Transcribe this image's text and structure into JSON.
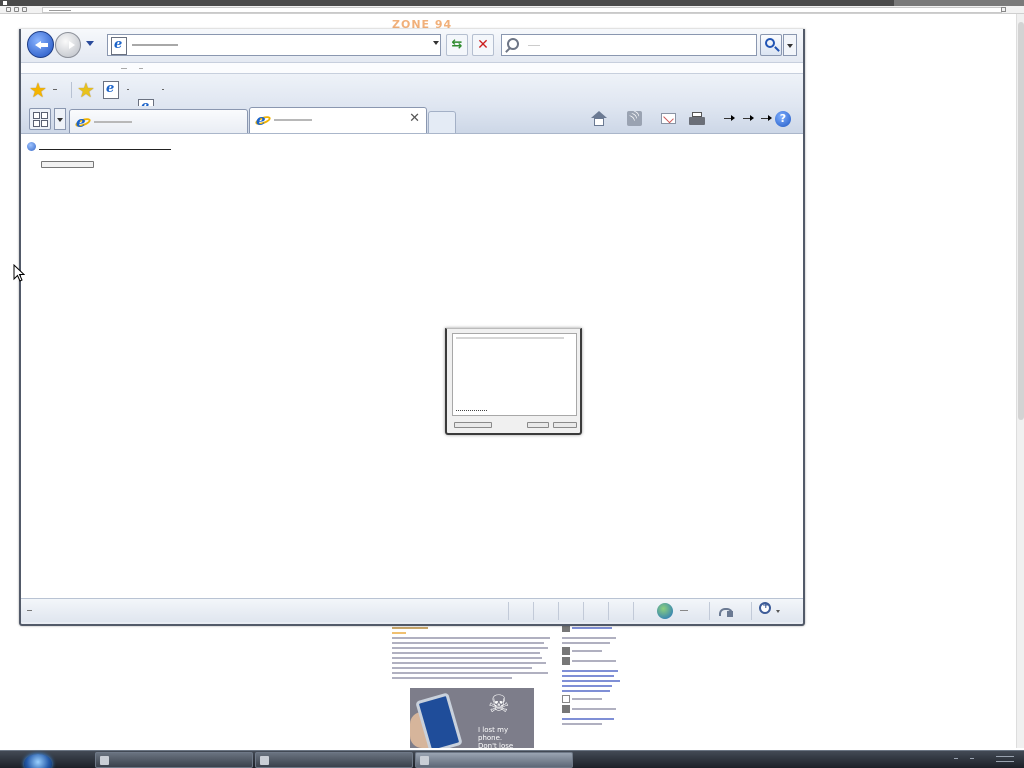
{
  "outer_page": {
    "logo_text": "ZONE 94",
    "ad_text": "I lost my phone.\nDon't lose yours."
  },
  "browser": {
    "address_bar": {
      "url": ""
    },
    "search_box": {
      "placeholder": ""
    },
    "tabs": [
      {
        "title": "",
        "state": "inactive"
      },
      {
        "title": "",
        "state": "active"
      }
    ]
  },
  "error_page": {
    "title": "",
    "subtitle": "",
    "button_label": "",
    "link_text": ""
  },
  "dialog": {
    "message": "",
    "link_text": "",
    "buttons": [
      "",
      "",
      ""
    ]
  },
  "taskbar": {
    "buttons": [
      {
        "label": ""
      },
      {
        "label": ""
      },
      {
        "label": "",
        "active": true
      }
    ]
  },
  "colors": {
    "accent_blue": "#1c4fbf",
    "stop_red": "#cc1f1f",
    "refresh_green": "#2e8b2e",
    "favorites_yellow": "#f4b400",
    "logo_orange": "#f1b07a"
  }
}
